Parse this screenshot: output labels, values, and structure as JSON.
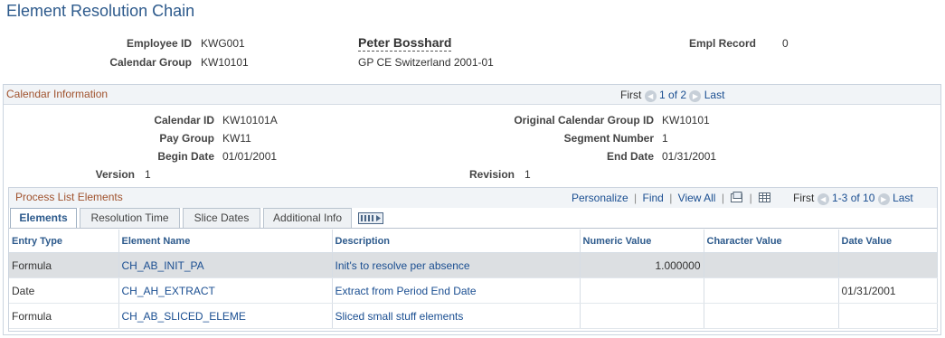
{
  "page": {
    "title": "Element Resolution Chain"
  },
  "employee": {
    "id_label": "Employee ID",
    "id_value": "KWG001",
    "name": "Peter Bosshard",
    "empl_record_label": "Empl Record",
    "empl_record_value": "0",
    "cal_group_label": "Calendar Group",
    "cal_group_value": "KW10101",
    "cal_group_desc": "GP CE Switzerland 2001-01"
  },
  "calendar": {
    "section_title": "Calendar Information",
    "nav": {
      "first": "First",
      "position": "1 of 2",
      "last": "Last"
    },
    "fields": {
      "calendar_id_label": "Calendar ID",
      "calendar_id_value": "KW10101A",
      "orig_cal_group_label": "Original Calendar Group ID",
      "orig_cal_group_value": "KW10101",
      "pay_group_label": "Pay Group",
      "pay_group_value": "KW11",
      "segment_label": "Segment Number",
      "segment_value": "1",
      "begin_date_label": "Begin Date",
      "begin_date_value": "01/01/2001",
      "end_date_label": "End Date",
      "end_date_value": "01/31/2001",
      "version_label": "Version",
      "version_value": "1",
      "revision_label": "Revision",
      "revision_value": "1"
    }
  },
  "process_list": {
    "section_title": "Process List Elements",
    "toolbar": {
      "personalize": "Personalize",
      "find": "Find",
      "view_all": "View All",
      "sep": "|"
    },
    "nav": {
      "first": "First",
      "position": "1-3 of 10",
      "last": "Last"
    },
    "tabs": [
      "Elements",
      "Resolution Time",
      "Slice Dates",
      "Additional Info"
    ],
    "columns": [
      "Entry Type",
      "Element Name",
      "Description",
      "Numeric Value",
      "Character Value",
      "Date Value"
    ],
    "rows": [
      {
        "entry_type": "Formula",
        "element_name": "CH_AB_INIT_PA",
        "description": "Init's to resolve per absence",
        "numeric": "1.000000",
        "character": "",
        "date": ""
      },
      {
        "entry_type": "Date",
        "element_name": "CH_AH_EXTRACT",
        "description": "Extract from Period End Date",
        "numeric": "",
        "character": "",
        "date": "01/31/2001"
      },
      {
        "entry_type": "Formula",
        "element_name": "CH_AB_SLICED_ELEME",
        "description": "Sliced small stuff elements",
        "numeric": "",
        "character": "",
        "date": ""
      }
    ]
  },
  "icons": {
    "nav_prev": "triangle-left-icon",
    "nav_next": "triangle-right-icon",
    "zoom": "zoom-grid-icon",
    "download": "download-grid-icon",
    "show_all_columns": "show-all-columns-icon"
  },
  "colors": {
    "title": "#2d5a8c",
    "section_title": "#a0522d",
    "link": "#1a4e91",
    "selected_row": "#dcdfe2"
  }
}
